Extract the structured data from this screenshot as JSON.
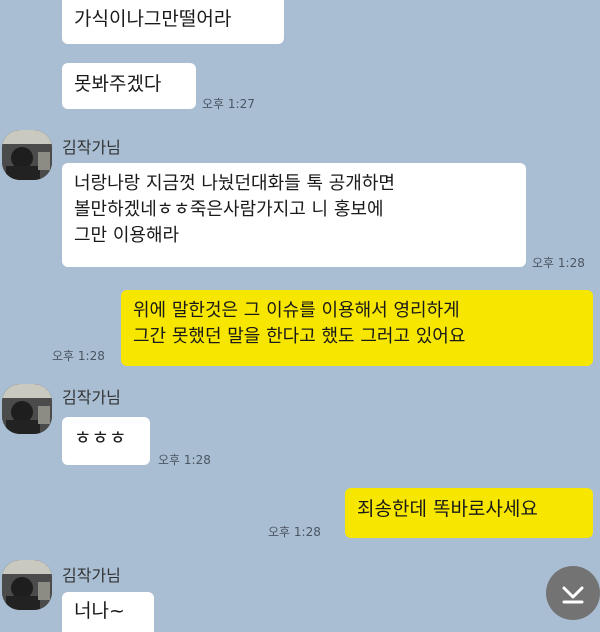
{
  "messages": [
    {
      "text": "가식이나그만떨어라"
    },
    {
      "text": "못봐주겠다",
      "time": "오후 1:27"
    },
    {
      "sender": "김작가님",
      "text": "너랑나랑 지금껏 나눴던대화들 톡 공개하면\n볼만하겠네ㅎㅎ죽은사람가지고 니 홍보에\n그만 이용해라",
      "time": "오후 1:28"
    },
    {
      "text": "위에 말한것은 그 이슈를 이용해서 영리하게\n그간 못했던 말을 한다고 했도 그러고 있어요",
      "time": "오후 1:28"
    },
    {
      "sender": "김작가님",
      "text": "ㅎㅎㅎ",
      "time": "오후 1:28"
    },
    {
      "text": "죄송한데 똑바로사세요",
      "time": "오후 1:28"
    },
    {
      "sender": "김작가님",
      "text": "너나~"
    }
  ],
  "colors": {
    "background": "#a9bed3",
    "incoming": "#ffffff",
    "outgoing": "#f7e600"
  },
  "icons": {
    "avatar": "profile-photo",
    "scroll": "chevron-down-to-bottom-icon"
  }
}
